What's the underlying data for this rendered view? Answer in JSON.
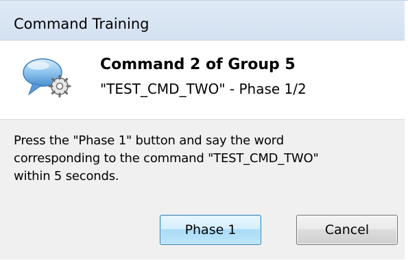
{
  "window": {
    "title": "Command Training"
  },
  "header": {
    "icon": "speech-bubble-gear-icon",
    "title": "Command 2 of Group 5",
    "subtitle": "\"TEST_CMD_TWO\" - Phase 1/2"
  },
  "message": {
    "line1": "Press the \"Phase 1\" button and say the word",
    "line2": "corresponding to the command \"TEST_CMD_TWO\"",
    "line3": "within 5 seconds."
  },
  "buttons": {
    "phase_label": "Phase 1",
    "cancel_label": "Cancel"
  },
  "colors": {
    "title_bar": "#d3e1f1",
    "primary_button_border": "#3c7fb1",
    "bubble": "#6fa8dc"
  }
}
